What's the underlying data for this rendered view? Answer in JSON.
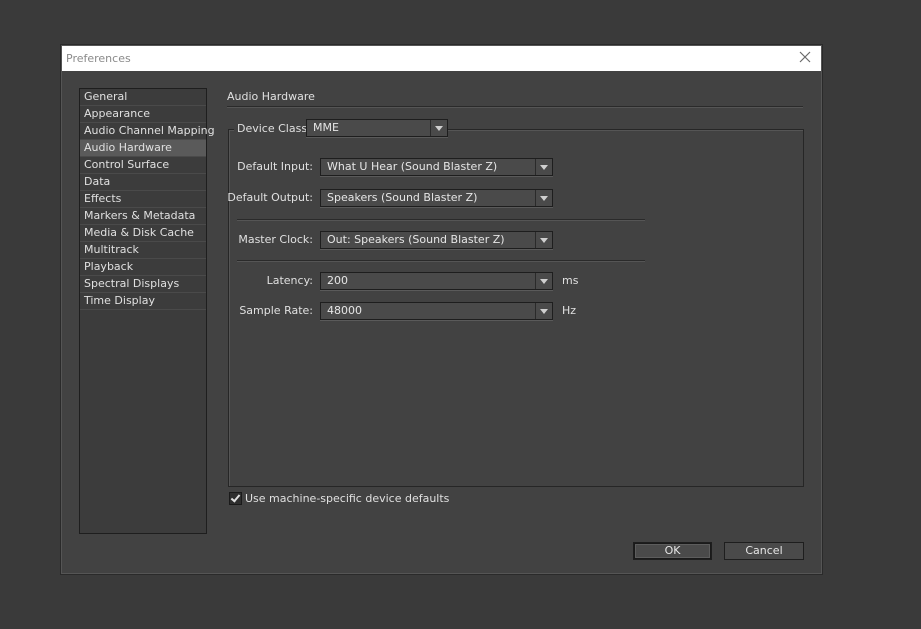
{
  "window": {
    "title": "Preferences",
    "close_icon": "close-icon"
  },
  "categories": [
    {
      "label": "General",
      "selected": false
    },
    {
      "label": "Appearance",
      "selected": false
    },
    {
      "label": "Audio Channel Mapping",
      "selected": false
    },
    {
      "label": "Audio Hardware",
      "selected": true
    },
    {
      "label": "Control Surface",
      "selected": false
    },
    {
      "label": "Data",
      "selected": false
    },
    {
      "label": "Effects",
      "selected": false
    },
    {
      "label": "Markers & Metadata",
      "selected": false
    },
    {
      "label": "Media & Disk Cache",
      "selected": false
    },
    {
      "label": "Multitrack",
      "selected": false
    },
    {
      "label": "Playback",
      "selected": false
    },
    {
      "label": "Spectral Displays",
      "selected": false
    },
    {
      "label": "Time Display",
      "selected": false
    }
  ],
  "panel": {
    "title": "Audio Hardware",
    "device_class": {
      "label": "Device Class:",
      "value": "MME"
    },
    "default_input": {
      "label": "Default Input:",
      "value": "What U Hear (Sound Blaster Z)"
    },
    "default_output": {
      "label": "Default Output:",
      "value": "Speakers (Sound Blaster Z)"
    },
    "master_clock": {
      "label": "Master Clock:",
      "value": "Out: Speakers (Sound Blaster Z)"
    },
    "latency": {
      "label": "Latency:",
      "value": "200",
      "unit": "ms"
    },
    "sample_rate": {
      "label": "Sample Rate:",
      "value": "48000",
      "unit": "Hz"
    },
    "machine_defaults": {
      "label": "Use machine-specific device defaults",
      "checked": true
    }
  },
  "buttons": {
    "ok": "OK",
    "cancel": "Cancel"
  },
  "colors": {
    "background": "#3a3a3a",
    "dialog": "#424242",
    "titlebar": "#ffffff",
    "selected_item": "#5a5a5a"
  }
}
